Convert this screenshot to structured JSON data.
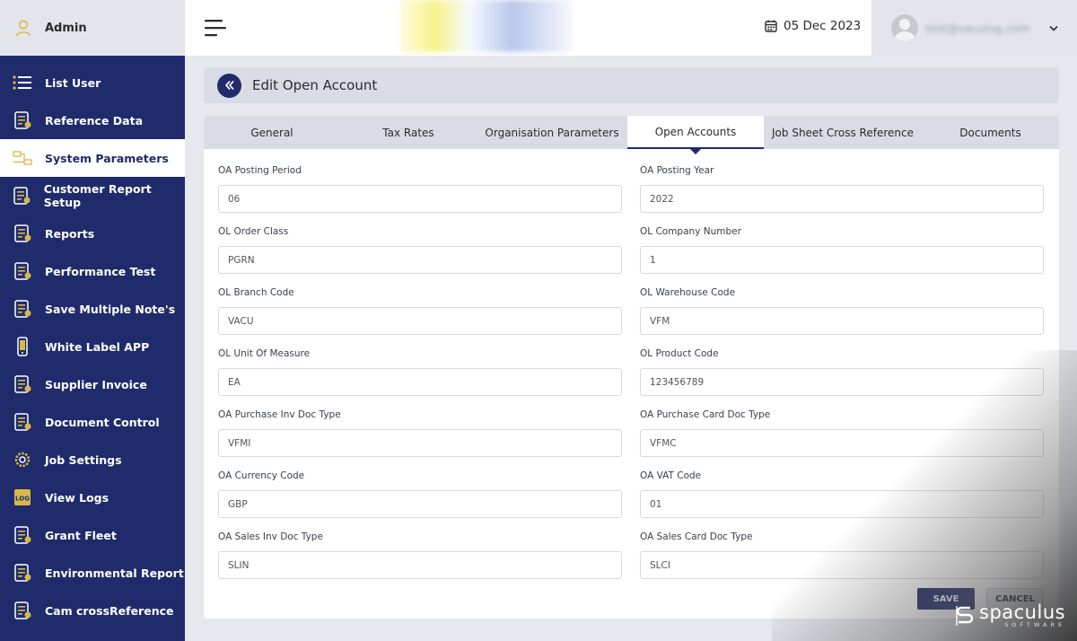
{
  "sidebar": {
    "user_label": "Admin",
    "items": [
      {
        "label": "List User",
        "icon": "list-icon"
      },
      {
        "label": "Reference Data",
        "icon": "reference-icon"
      },
      {
        "label": "System Parameters",
        "icon": "parameters-icon",
        "active": true
      },
      {
        "label": "Customer Report Setup",
        "icon": "report-setup-icon"
      },
      {
        "label": "Reports",
        "icon": "reports-icon"
      },
      {
        "label": "Performance Test",
        "icon": "performance-icon"
      },
      {
        "label": "Save Multiple Note's",
        "icon": "notes-icon"
      },
      {
        "label": "White Label APP",
        "icon": "mobile-app-icon"
      },
      {
        "label": "Supplier Invoice",
        "icon": "invoice-icon"
      },
      {
        "label": "Document Control",
        "icon": "document-icon"
      },
      {
        "label": "Job Settings",
        "icon": "settings-gear-icon"
      },
      {
        "label": "View Logs",
        "icon": "log-icon"
      },
      {
        "label": "Grant Fleet",
        "icon": "fleet-icon"
      },
      {
        "label": "Environmental Report",
        "icon": "environment-icon"
      },
      {
        "label": "Cam crossReference",
        "icon": "crossreference-icon"
      }
    ]
  },
  "header": {
    "date": "05 Dec 2023",
    "user_email": "test@vaculug.com"
  },
  "page": {
    "title": "Edit Open Account"
  },
  "tabs": [
    {
      "label": "General",
      "width": 152
    },
    {
      "label": "Tax Rates",
      "width": 152
    },
    {
      "label": "Organisation Parameters",
      "width": 168
    },
    {
      "label": "Open Accounts",
      "width": 152,
      "active": true
    },
    {
      "label": "Job Sheet Cross Reference",
      "width": 176
    },
    {
      "label": "Documents",
      "width": 153
    }
  ],
  "form": {
    "rows": [
      [
        {
          "label": "OA Posting Period",
          "value": "06"
        },
        {
          "label": "OA Posting Year",
          "value": "2022"
        }
      ],
      [
        {
          "label": "OL Order Class",
          "value": "PGRN"
        },
        {
          "label": "OL Company Number",
          "value": "1"
        }
      ],
      [
        {
          "label": "OL Branch Code",
          "value": "VACU"
        },
        {
          "label": "OL Warehouse Code",
          "value": "VFM"
        }
      ],
      [
        {
          "label": "OL Unit Of Measure",
          "value": "EA"
        },
        {
          "label": "OL Product Code",
          "value": "123456789"
        }
      ],
      [
        {
          "label": "OA Purchase Inv Doc Type",
          "value": "VFMI"
        },
        {
          "label": "OA Purchase Card Doc Type",
          "value": "VFMC"
        }
      ],
      [
        {
          "label": "OA Currency Code",
          "value": "GBP"
        },
        {
          "label": "OA VAT Code",
          "value": "01"
        }
      ],
      [
        {
          "label": "OA Sales Inv Doc Type",
          "value": "SLIN"
        },
        {
          "label": "OA Sales Card Doc Type",
          "value": "SLCI"
        }
      ]
    ],
    "save_label": "SAVE",
    "cancel_label": "CANCEL"
  },
  "watermark": {
    "name": "spaculus",
    "sub": "SOFTWARE"
  },
  "colors": {
    "sidebar_bg": "#1f2b6b",
    "accent_icon": "#d9b84a"
  }
}
